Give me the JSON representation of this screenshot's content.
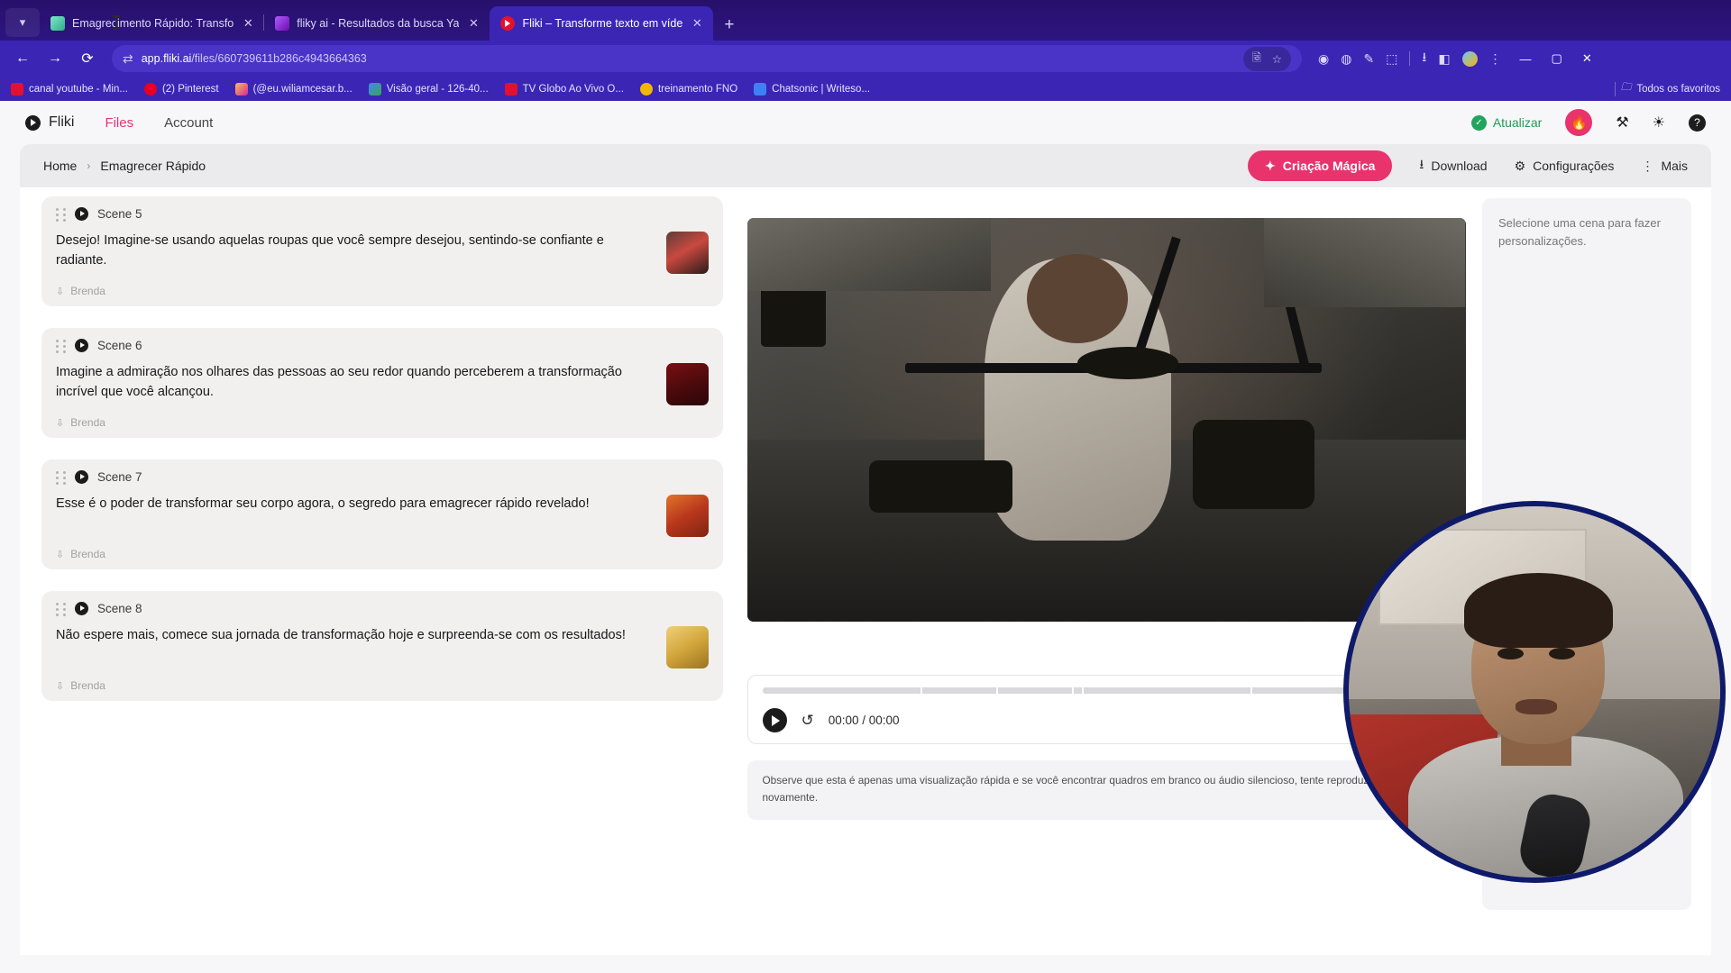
{
  "browser": {
    "tabs": [
      {
        "title": "Emagrecimento Rápido: Transfo",
        "favicon": "note-icon",
        "active": false
      },
      {
        "title": "fliky ai - Resultados da busca Ya",
        "favicon": "yahoo-icon",
        "active": false
      },
      {
        "title": "Fliki – Transforme texto em víde",
        "favicon": "fliki-icon",
        "active": true
      }
    ],
    "new_tab_label": "+",
    "tab_close_label": "✕",
    "tab_list_icon": "chevron-down-icon",
    "nav": {
      "back_icon": "←",
      "forward_icon": "→",
      "reload_icon": "⟳",
      "site_settings_icon": "tune-icon"
    },
    "omnibox": {
      "url_strong": "app.fliki.ai",
      "url_rest": "/files/660739611b286c4943664363",
      "translate_icon": "translate-icon",
      "bookmark_icon": "☆"
    },
    "toolbar_icons": [
      "extension-shield-icon",
      "sync-icon",
      "eyedropper-icon",
      "puzzle-icon",
      "download-icon",
      "side-panel-icon",
      "profile-avatar-icon",
      "more-menu-icon"
    ],
    "window_controls": {
      "minimize": "—",
      "maximize": "▢",
      "close": "✕"
    },
    "bookmarks": [
      {
        "label": "canal youtube - Min...",
        "color": "#e3112f"
      },
      {
        "label": "(2) Pinterest",
        "color": "#e60023"
      },
      {
        "label": "(@eu.wiliamcesar.b...",
        "color": "#d6249f"
      },
      {
        "label": "Visão geral - 126-40...",
        "color": "#1a73e8"
      },
      {
        "label": "TV Globo Ao Vivo O...",
        "color": "#e3112f"
      },
      {
        "label": "treinamento FNO",
        "color": "#f2b705"
      },
      {
        "label": "Chatsonic | Writeso...",
        "color": "#3b82f6"
      }
    ],
    "all_bookmarks_label": "Todos os favoritos",
    "all_bookmarks_icon": "folder-icon"
  },
  "app": {
    "brand": "Fliki",
    "nav_links": [
      {
        "label": "Files",
        "active": true
      },
      {
        "label": "Account",
        "active": false
      }
    ],
    "upgrade_label": "Atualizar",
    "header_icons": [
      "flame-avatar-icon",
      "tools-icon",
      "theme-icon",
      "help-icon"
    ],
    "toolbar": {
      "breadcrumb": [
        "Home",
        "Emagrecer Rápido"
      ],
      "breadcrumb_separator": "›",
      "magic_label": "Criação Mágica",
      "magic_icon": "sparkle-icon",
      "download_label": "Download",
      "download_icon": "download-icon",
      "settings_label": "Configurações",
      "settings_icon": "gear-icon",
      "more_label": "Mais",
      "more_icon": "vertical-dots-icon"
    },
    "scenes": [
      {
        "label": "Scene 5",
        "text": "Desejo! Imagine-se usando aquelas roupas que você sempre desejou, sentindo-se confiante e radiante.",
        "voice": "Brenda",
        "thumb": "thumb-a"
      },
      {
        "label": "Scene 6",
        "text": "Imagine a admiração nos olhares das pessoas ao seu redor quando perceberem a transformação incrível que você alcançou.",
        "voice": "Brenda",
        "thumb": "thumb-b"
      },
      {
        "label": "Scene 7",
        "text": "Esse é o poder de transformar seu corpo agora, o segredo para emagrecer rápido revelado!",
        "voice": "Brenda",
        "thumb": "thumb-c"
      },
      {
        "label": "Scene 8",
        "text": "Não espere mais, comece sua jornada de transformação hoje e surpreenda-se com os resultados!",
        "voice": "Brenda",
        "thumb": "thumb-d"
      }
    ],
    "player": {
      "play_icon": "play-icon",
      "replay_icon": "replay-icon",
      "time_display": "00:00 / 00:00",
      "current_time": "00:00",
      "duration": "00:00"
    },
    "toast": {
      "message": "Observe que esta é apenas uma visualização rápida e se você encontrar quadros em branco ou áudio silencioso, tente reproduzir novamente.",
      "close_label": "✕"
    },
    "right_panel": {
      "empty_message": "Selecione uma cena para fazer personalizações."
    }
  },
  "colors": {
    "browser_chrome": "#3b25b5",
    "accent_pink": "#e8336d",
    "upgrade_green": "#22a45d",
    "webcam_ring": "#0f1a6b"
  }
}
